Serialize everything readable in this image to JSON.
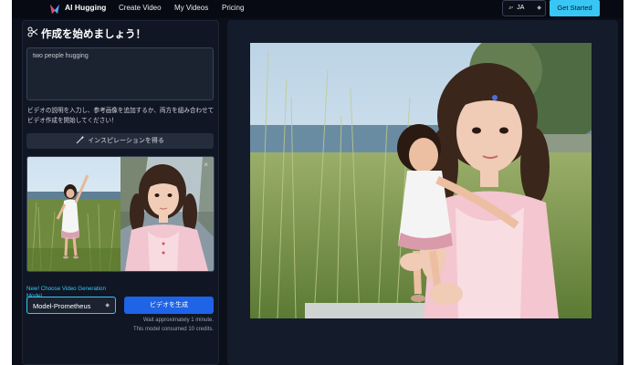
{
  "nav": {
    "brand": "AI Hugging",
    "links": [
      "Create Video",
      "My Videos",
      "Pricing"
    ],
    "language": "JA",
    "language_flag": "JP",
    "cta": "Get Started"
  },
  "form": {
    "title": "作成を始めましょう！",
    "prompt_value": "two people hugging",
    "helper": "ビデオの説明を入力し、参考画像を追加するか、両方を組み合わせてビデオ作成を開始してください！",
    "inspiration_label": "インスピレーションを得る",
    "remove_icon": "×",
    "model_heading": "New! Choose Video Generation Model",
    "model_value": "Model-Prometheus",
    "generate_label": "ビデオを生成",
    "wait_note": "Wait approximately 1 minute.",
    "credits_note": "This model consumed 10 credits."
  },
  "colors": {
    "accent": "#38c6f4",
    "primary_button": "#1f63e6",
    "background": "#0b0f1a",
    "panel": "#101624"
  },
  "icons": {
    "logo": "heart-logo-icon",
    "title": "scissors-icon",
    "inspiration": "magic-wand-icon",
    "select": "chevron-updown-icon",
    "close": "close-icon"
  }
}
